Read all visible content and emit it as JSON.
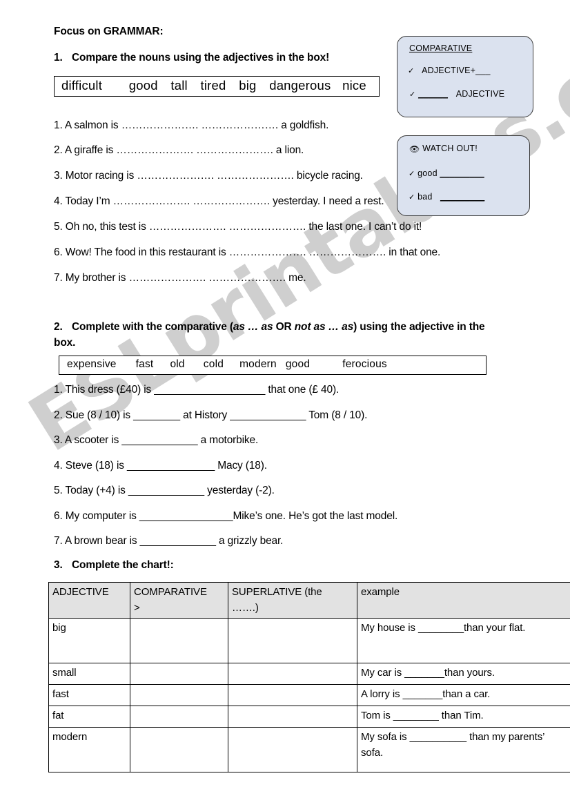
{
  "document": {
    "heading": "Focus on GRAMMAR:",
    "watermark": "ESLprintables.com"
  },
  "exercise1": {
    "number": "1.",
    "instruction": "Compare the nouns using the adjectives in the box!",
    "wordbank": [
      "difficult",
      "good",
      "tall",
      "tired",
      "big",
      "dangerous",
      "nice"
    ],
    "items": [
      "1. A salmon is …………………. …………………. a goldfish.",
      "2. A giraffe is …………………. …………………. a lion.",
      "3. Motor racing is …………………. …………………. bicycle racing.",
      "4. Today I’m …………………. …………………. yesterday. I need a rest.",
      "5. Oh no, this test is …………………. …………………. the last one. I can’t do it!",
      "6. Wow! The food in this restaurant is …………………. …………………. in that one.",
      "7. My brother is …………………. …………………. me."
    ]
  },
  "exercise2": {
    "number": "2.",
    "instruction_part1": "Complete with the comparative (",
    "instruction_italic1": "as … as",
    "instruction_mid": " OR ",
    "instruction_italic2": "not as … as",
    "instruction_part2": ") using the adjective in the",
    "instruction_line2": "box.",
    "wordbank": [
      "expensive",
      "fast",
      "old",
      "cold",
      "modern",
      "good",
      "ferocious"
    ],
    "items": [
      "1. This dress (£40) is ___________________ that one (£ 40).",
      "2. Sue (8 / 10) is ________ at History _____________ Tom (8 / 10).",
      "3. A scooter is _____________ a motorbike.",
      "4. Steve (18) is _______________ Macy (18).",
      "5. Today (+4) is _____________ yesterday (-2).",
      "6. My computer is ________________Mike’s one. He’s got the last model.",
      "7. A brown bear is _____________ a grizzly bear."
    ]
  },
  "exercise3": {
    "number": "3.",
    "instruction": "Complete the chart!:",
    "table": {
      "headers": [
        "ADJECTIVE",
        "COMPARATIVE >",
        "SUPERLATIVE (the …….)",
        "example"
      ],
      "header_col2_line1": "COMPARATIVE",
      "header_col2_line2": ">",
      "header_col3_line1": "SUPERLATIVE (the",
      "header_col3_line2": "…….)",
      "rows": [
        {
          "adjective": "big",
          "comparative": "",
          "superlative": "",
          "example": "My house is ________than your flat."
        },
        {
          "adjective": "small",
          "comparative": "",
          "superlative": "",
          "example": "My car is _______than yours."
        },
        {
          "adjective": "fast",
          "comparative": "",
          "superlative": "",
          "example": "A lorry is _______than a car."
        },
        {
          "adjective": "fat",
          "comparative": "",
          "superlative": "",
          "example": "Tom is ________ than Tim."
        },
        {
          "adjective": "modern",
          "comparative": "",
          "superlative": "",
          "example": "My sofa is __________ than my parents’ sofa."
        }
      ]
    }
  },
  "infoboxes": {
    "comparative": {
      "title": "COMPARATIVE",
      "tick": "✓",
      "rule1": "ADJECTIVE+___",
      "rule2_blank": "______",
      "rule2_word": "ADJECTIVE"
    },
    "watchout": {
      "icon": "👁",
      "title": "WATCH OUT!",
      "tick": "✓",
      "item1_word": "good",
      "item1_blank": "_________",
      "item2_word": "bad",
      "item2_blank": "_________"
    }
  },
  "colors": {
    "infobox_fill": "#dbe2ef",
    "table_header_fill": "#e2e2e2",
    "watermark": "#cfcfcf"
  }
}
